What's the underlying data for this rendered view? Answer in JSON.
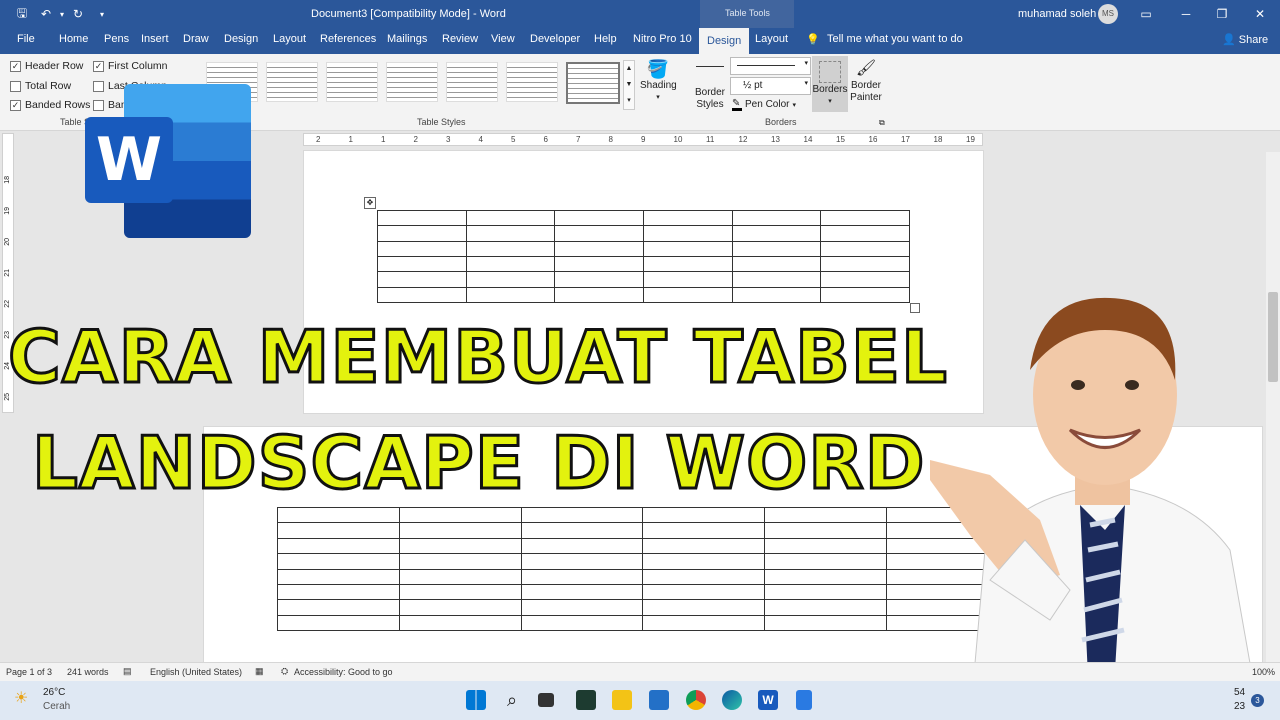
{
  "titlebar": {
    "title": "Document3 [Compatibility Mode]  -  Word",
    "context_tab_group": "Table Tools",
    "user_name": "muhamad soleh",
    "user_initials": "MS"
  },
  "tabs": [
    "File",
    "Home",
    "Pens",
    "Insert",
    "Draw",
    "Design",
    "Layout",
    "References",
    "Mailings",
    "Review",
    "View",
    "Developer",
    "Help",
    "Nitro Pro 10"
  ],
  "context_tabs": {
    "design": "Design",
    "layout": "Layout"
  },
  "tell_me": "Tell me what you want to do",
  "share": "Share",
  "ribbon": {
    "options": [
      {
        "label": "Header Row",
        "checked": true
      },
      {
        "label": "First Column",
        "checked": true
      },
      {
        "label": "Total Row",
        "checked": false
      },
      {
        "label": "Last Column",
        "checked": false
      },
      {
        "label": "Banded Rows",
        "checked": true
      },
      {
        "label": "Banded Columns",
        "checked": false
      }
    ],
    "options_group_label": "Table Style Options",
    "table_styles_label": "Table Styles",
    "shading_label": "Shading",
    "border_styles_label": "Border Styles",
    "pen_weight": "½ pt",
    "pen_color_label": "Pen Color",
    "borders_label": "Borders",
    "border_painter_label": "Border Painter",
    "borders_group_label": "Borders"
  },
  "ruler": {
    "ticks": [
      "2",
      "1",
      "1",
      "2",
      "3",
      "4",
      "5",
      "6",
      "7",
      "8",
      "9",
      "10",
      "11",
      "12",
      "13",
      "14",
      "15",
      "16",
      "17",
      "18",
      "19"
    ],
    "vticks": [
      "18",
      "19",
      "20",
      "21",
      "22",
      "23",
      "24",
      "25"
    ]
  },
  "overlay": {
    "line1": "CARA MEMBUAT TABEL",
    "line2": "LANDSCAPE DI WORD",
    "logo_letter": "W"
  },
  "status": {
    "page": "Page 1 of 3",
    "words": "241 words",
    "language": "English (United States)",
    "accessibility": "Accessibility: Good to go",
    "zoom": "100%"
  },
  "weather": {
    "temp": "26°C",
    "condition": "Cerah"
  },
  "taskbar_clock": {
    "time": "54",
    "date": "23"
  },
  "notification_count": "3",
  "colors": {
    "word_blue": "#2b579a",
    "overlay_text": "#e3f20e",
    "overlay_stroke": "#111111"
  }
}
